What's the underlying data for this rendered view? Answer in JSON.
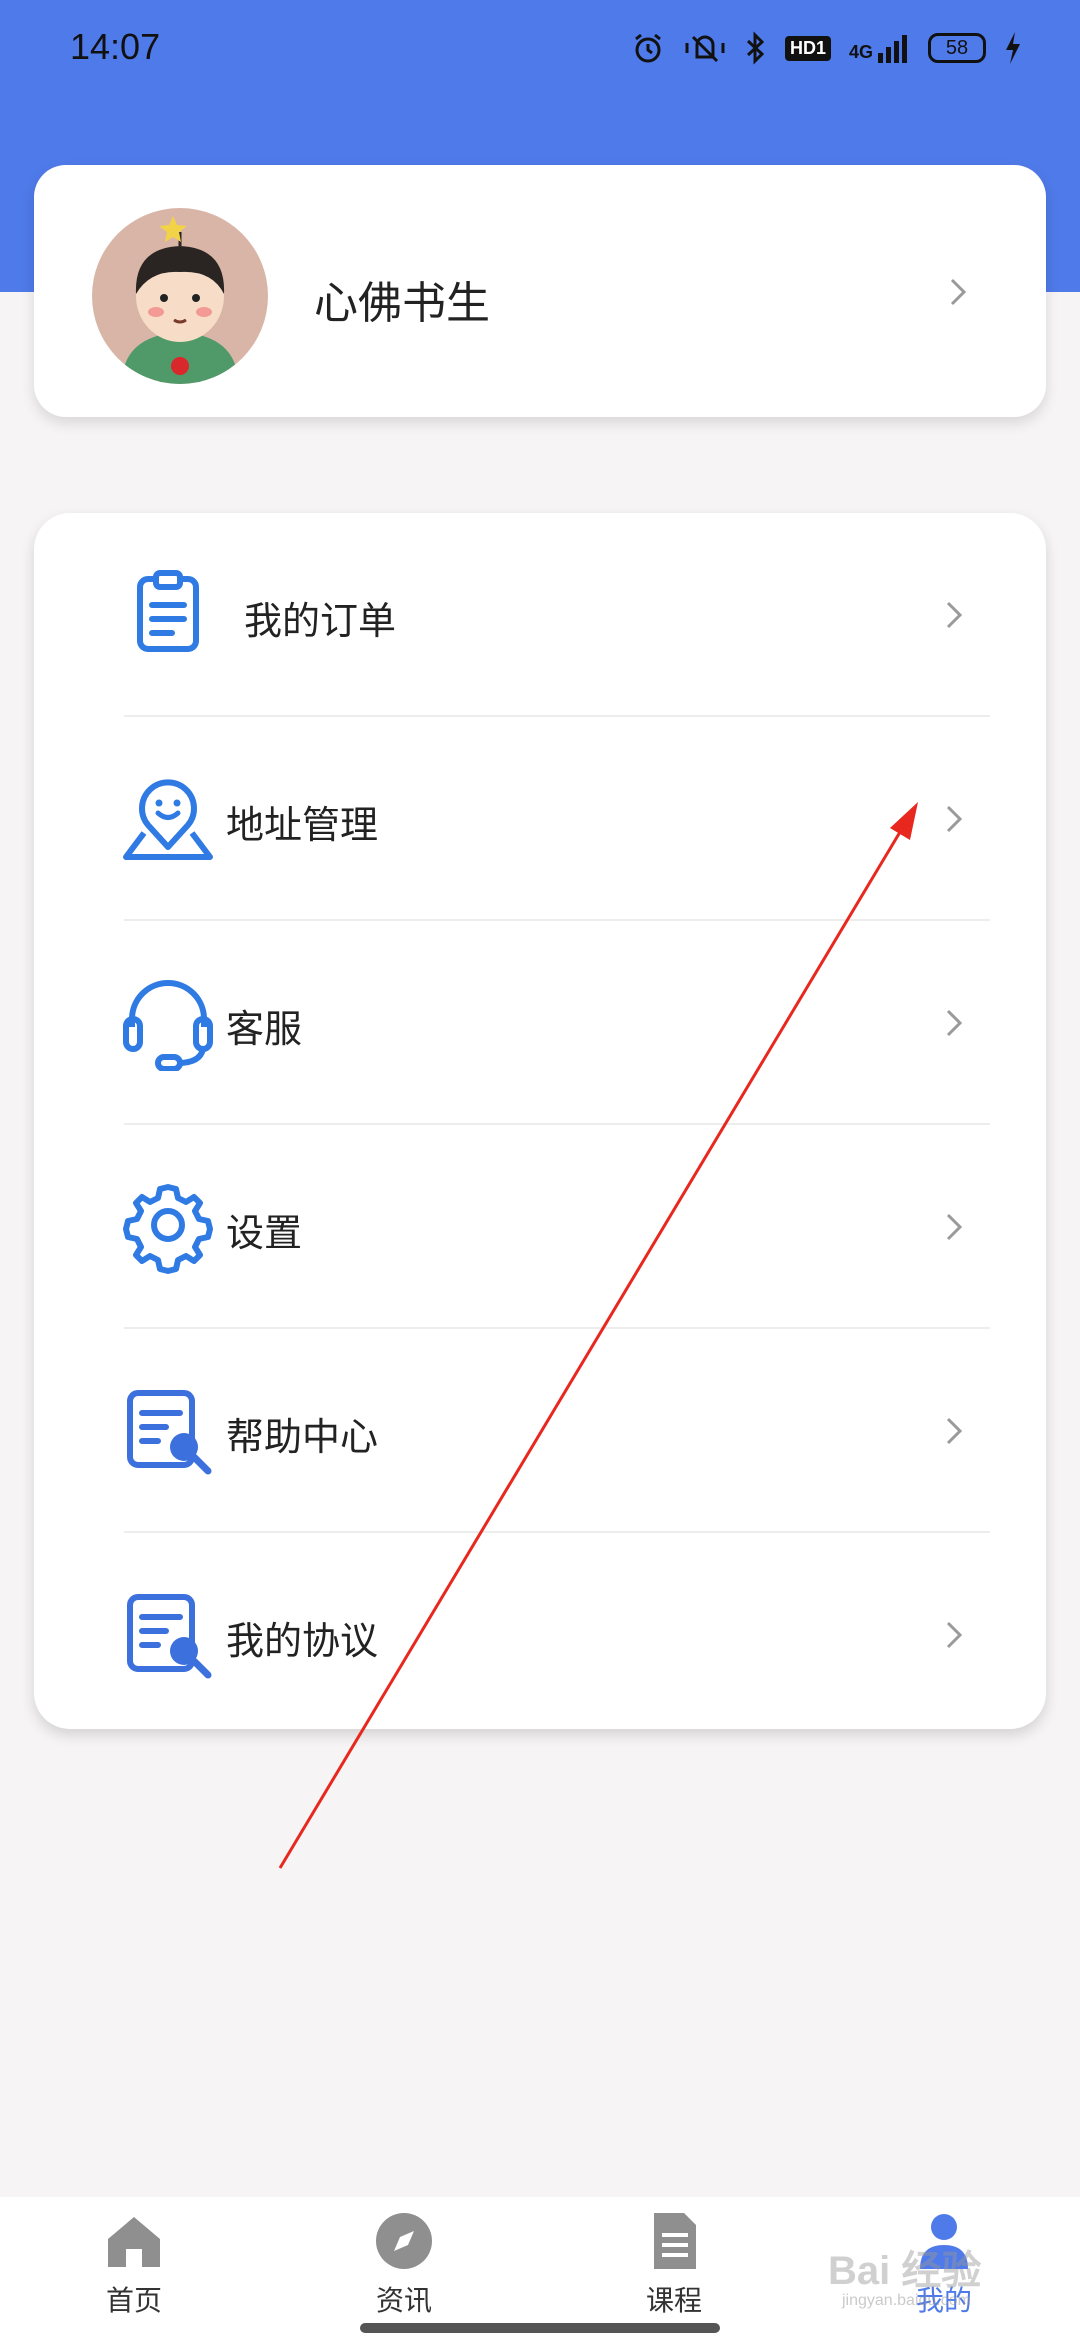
{
  "status_bar": {
    "time": "14:07",
    "network": "4G",
    "hd": "HD1",
    "battery": "58",
    "icons": [
      "alarm-icon",
      "mute-vibrate-icon",
      "bluetooth-icon",
      "signal-icon",
      "charging-icon"
    ]
  },
  "profile": {
    "name": "心佛书生"
  },
  "menu": {
    "items": [
      {
        "label": "我的订单",
        "icon": "order-clipboard-icon"
      },
      {
        "label": "地址管理",
        "icon": "address-pin-icon"
      },
      {
        "label": "客服",
        "icon": "headset-icon"
      },
      {
        "label": "设置",
        "icon": "gear-icon"
      },
      {
        "label": "帮助中心",
        "icon": "help-search-icon"
      },
      {
        "label": "我的协议",
        "icon": "agreement-search-icon"
      }
    ]
  },
  "tab_bar": {
    "tabs": [
      {
        "label": "首页",
        "icon": "home-icon"
      },
      {
        "label": "资讯",
        "icon": "compass-icon"
      },
      {
        "label": "课程",
        "icon": "document-icon"
      },
      {
        "label": "我的",
        "icon": "user-icon",
        "active": true
      }
    ]
  },
  "watermark": {
    "text": "Bai 经验",
    "sub": "jingyan.baidu.com"
  },
  "colors": {
    "header_blue": "#4f7ae9",
    "icon_blue": "#2f7be3",
    "annotation_red": "#e8281e"
  }
}
